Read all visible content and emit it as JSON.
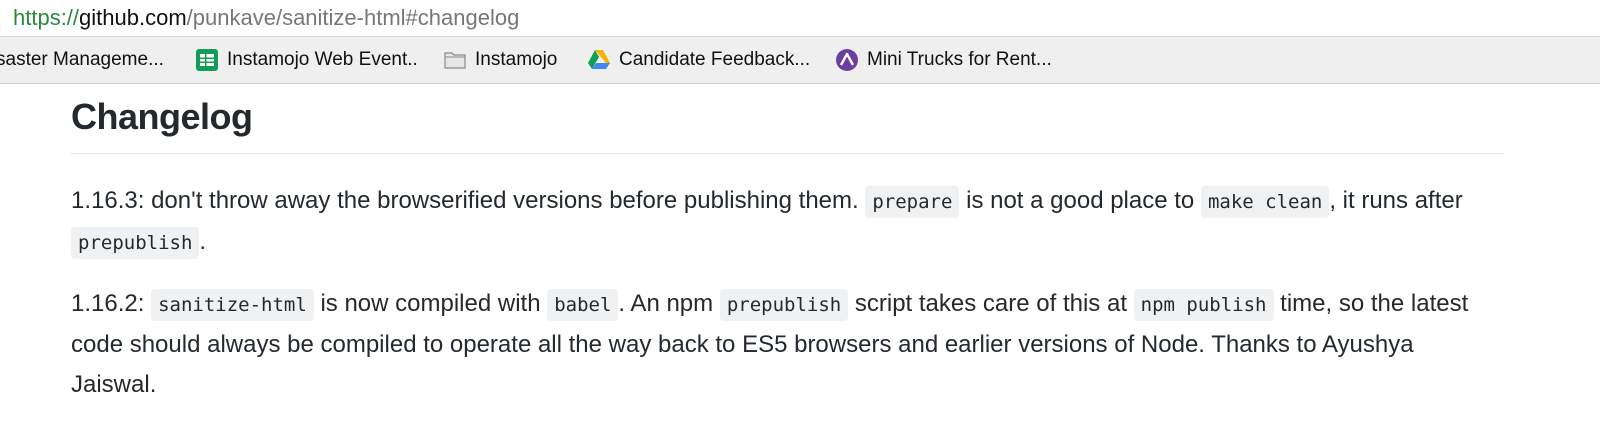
{
  "browser": {
    "url": {
      "scheme": "https://",
      "host": "github.com",
      "path": "/punkave/sanitize-html#changelog"
    },
    "bookmarks": [
      {
        "label": "saster Manageme...",
        "icon": "none"
      },
      {
        "label": "Instamojo Web Event..",
        "icon": "google-sheets-icon"
      },
      {
        "label": "Instamojo",
        "icon": "folder-icon"
      },
      {
        "label": "Candidate Feedback...",
        "icon": "google-drive-icon"
      },
      {
        "label": "Mini Trucks for Rent...",
        "icon": "site-favicon-icon"
      }
    ]
  },
  "page": {
    "title": "Changelog",
    "entries": [
      {
        "parts": [
          "1.16.3: don't throw away the browserified versions before publishing them. ",
          "prepare",
          " is not a good place to ",
          "make clean",
          ", it runs after ",
          "prepublish",
          "."
        ]
      },
      {
        "parts": [
          "1.16.2: ",
          "sanitize-html",
          " is now compiled with ",
          "babel",
          ". An npm ",
          "prepublish",
          " script takes care of this at ",
          "npm publish",
          " time, so the latest code should always be compiled to operate all the way back to ES5 browsers and earlier versions of Node. Thanks to Ayushya Jaiswal."
        ]
      }
    ]
  },
  "colors": {
    "scheme": "#2a8a3e",
    "code_bg": "#f0f1f2",
    "sheets_green": "#0f9d58",
    "favicon_purple": "#6a3fa0"
  }
}
